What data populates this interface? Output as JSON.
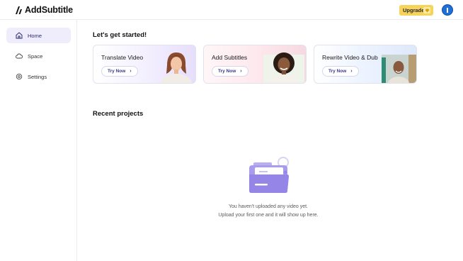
{
  "app": {
    "name": "AddSubtitle"
  },
  "header": {
    "upgrade_label": "Upgrade",
    "avatar_initial": ""
  },
  "sidebar": {
    "items": [
      {
        "label": "Home",
        "icon": "home-icon",
        "active": true
      },
      {
        "label": "Space",
        "icon": "cloud-icon",
        "active": false
      },
      {
        "label": "Settings",
        "icon": "gear-icon",
        "active": false
      }
    ]
  },
  "main": {
    "get_started_title": "Let's get started!",
    "cards": [
      {
        "title": "Translate Video",
        "button": "Try Now"
      },
      {
        "title": "Add Subtitles",
        "button": "Try Now"
      },
      {
        "title": "Rewrite Video & Dub",
        "button": "Try Now"
      }
    ],
    "recent_title": "Recent projects",
    "empty_line1": "You haven't uploaded any video yet.",
    "empty_line2": "Upload your first one and it will show up here."
  },
  "colors": {
    "accent": "#7b68ee",
    "upgrade_bg": "#f6d35b",
    "avatar_bg": "#1f6fd6",
    "active_nav_bg": "#efedfb"
  }
}
